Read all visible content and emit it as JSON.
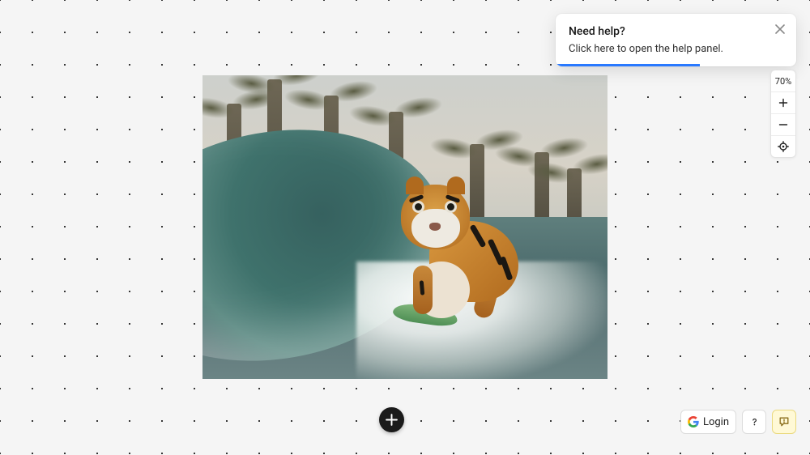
{
  "popover": {
    "title": "Need help?",
    "body": "Click here to open the help panel."
  },
  "zoom": {
    "level_label": "70%"
  },
  "footer": {
    "login_label": "Login"
  },
  "canvas": {
    "image_description": "A tiger riding a surfboard on an ocean wave with palm trees in the background"
  }
}
